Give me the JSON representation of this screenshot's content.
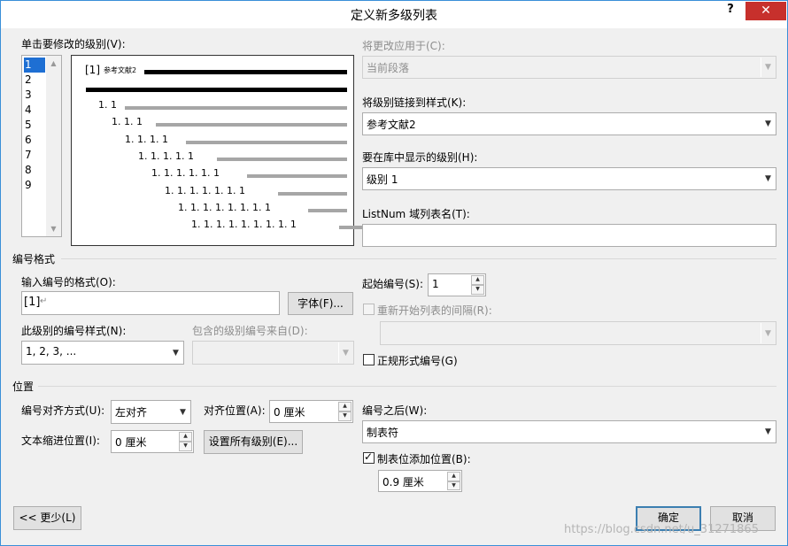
{
  "window": {
    "title": "定义新多级列表",
    "help": "?",
    "close": "✕"
  },
  "levels": {
    "label": "单击要修改的级别(V):",
    "items": [
      "1",
      "2",
      "3",
      "4",
      "5",
      "6",
      "7",
      "8",
      "9"
    ],
    "selected": "1"
  },
  "preview": {
    "first_line": "[1]",
    "first_style": "参考文献2",
    "lines": [
      "1. 1",
      "1. 1. 1",
      "1. 1. 1. 1",
      "1. 1. 1. 1. 1",
      "1. 1. 1. 1. 1. 1",
      "1. 1. 1. 1. 1. 1. 1",
      "1. 1. 1. 1. 1. 1. 1. 1",
      "1. 1. 1. 1. 1. 1. 1. 1. 1"
    ]
  },
  "right_panel": {
    "apply_to_label": "将更改应用于(C):",
    "apply_to_value": "当前段落",
    "link_style_label": "将级别链接到样式(K):",
    "link_style_value": "参考文献2",
    "gallery_level_label": "要在库中显示的级别(H):",
    "gallery_level_value": "级别 1",
    "listnum_label": "ListNum 域列表名(T):",
    "listnum_value": ""
  },
  "number_format": {
    "section": "编号格式",
    "format_label": "输入编号的格式(O):",
    "format_value": "[1]",
    "format_mark": "↵",
    "font_button": "字体(F)...",
    "style_label": "此级别的编号样式(N):",
    "style_value": "1, 2, 3, ...",
    "include_label": "包含的级别编号来自(D):",
    "include_value": "",
    "start_label": "起始编号(S):",
    "start_value": "1",
    "restart_label": "重新开始列表的间隔(R):",
    "restart_value": "",
    "legal_label": "正规形式编号(G)"
  },
  "position": {
    "section": "位置",
    "align_label": "编号对齐方式(U):",
    "align_value": "左对齐",
    "align_at_label": "对齐位置(A):",
    "align_at_value": "0 厘米",
    "indent_label": "文本缩进位置(I):",
    "indent_value": "0 厘米",
    "set_all_button": "设置所有级别(E)...",
    "follow_label": "编号之后(W):",
    "follow_value": "制表符",
    "tab_label": "制表位添加位置(B):",
    "tab_value": "0.9 厘米"
  },
  "footer": {
    "less_button": "<< 更少(L)",
    "ok_button": "确定",
    "cancel_button": "取消",
    "watermark": "https://blog.csdn.net/u_31271865"
  }
}
